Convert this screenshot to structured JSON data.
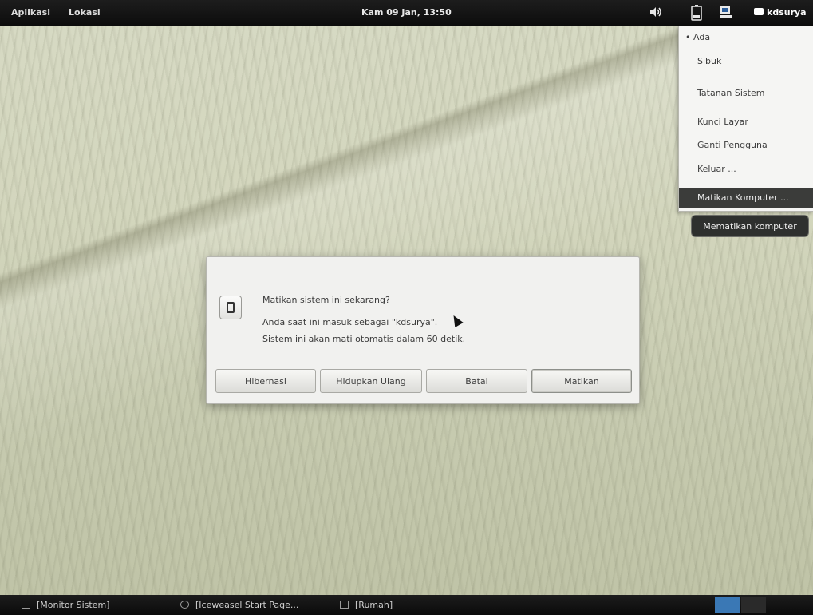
{
  "top_panel": {
    "applications_label": "Aplikasi",
    "places_label": "Lokasi",
    "clock": "Kam 09 Jan, 13:50",
    "username": "kdsurya",
    "icons": [
      "volume-icon",
      "battery-icon",
      "chat-icon",
      "user-chat-icon"
    ]
  },
  "user_menu": {
    "status_available": "Ada",
    "status_available_mark": "•",
    "status_busy": "Sibuk",
    "system_settings": "Tatanan Sistem",
    "lock_screen": "Kunci Layar",
    "switch_user": "Ganti Pengguna",
    "log_out": "Keluar ...",
    "power_off": "Matikan Komputer ..."
  },
  "tooltip": "Mematikan komputer",
  "dialog": {
    "title": "Matikan sistem ini sekarang?",
    "line1": "Anda saat ini masuk sebagai \"kdsurya\".",
    "line2": "Sistem ini akan mati otomatis dalam 60 detik.",
    "buttons": {
      "hibernate": "Hibernasi",
      "restart": "Hidupkan Ulang",
      "cancel": "Batal",
      "shutdown": "Matikan"
    }
  },
  "taskbar": {
    "tasks": [
      {
        "label": "[Monitor Sistem]",
        "icon": "monitor-icon"
      },
      {
        "label": "[Iceweasel Start Page...",
        "icon": "browser-icon"
      },
      {
        "label": "[Rumah]",
        "icon": "folder-icon"
      }
    ],
    "workspaces": [
      "workspace-1",
      "workspace-2"
    ],
    "colors": {
      "active_workspace": "#3a78b5",
      "inactive_workspace": "#2a2a2a"
    }
  }
}
